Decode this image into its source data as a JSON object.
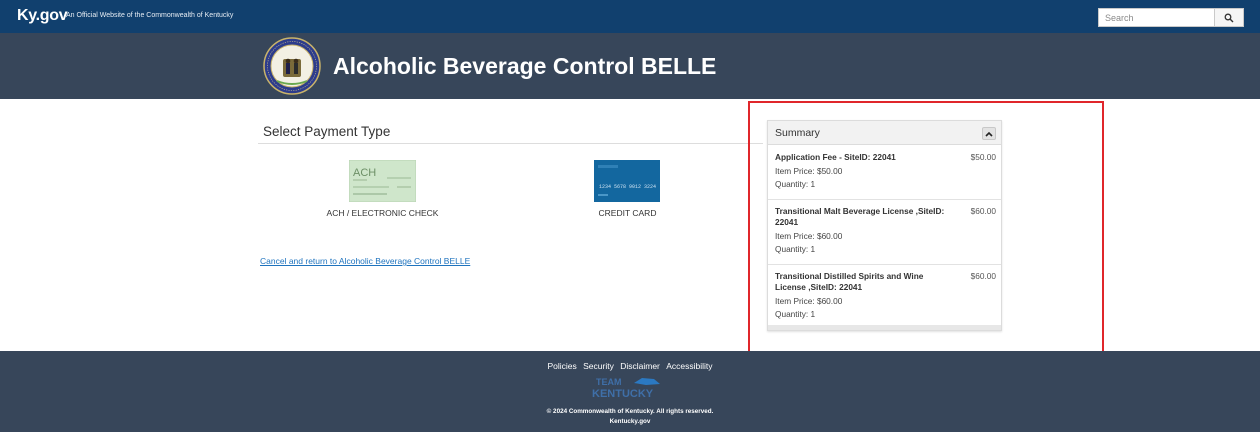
{
  "topbar": {
    "brand": "Ky.gov",
    "official_text": "An Official Website of the Commonwealth of Kentucky",
    "search_placeholder": "Search"
  },
  "header": {
    "title": "Alcoholic Beverage Control BELLE"
  },
  "payment": {
    "heading": "Select Payment Type",
    "ach_label": "ACH / ELECTRONIC CHECK",
    "card_label": "CREDIT CARD",
    "card_number": "1234 5678 9012 3224"
  },
  "cancel_link": "Cancel and return to Alcoholic Beverage Control BELLE",
  "summary": {
    "title": "Summary",
    "items": [
      {
        "name": "Application Fee - SiteID: 22041",
        "amount": "$50.00",
        "price": "Item Price: $50.00",
        "qty": "Quantity: 1"
      },
      {
        "name": "Transitional Malt Beverage License ,SiteID: 22041",
        "amount": "$60.00",
        "price": "Item Price: $60.00",
        "qty": "Quantity: 1"
      },
      {
        "name": "Transitional Distilled Spirits and Wine License ,SiteID: 22041",
        "amount": "$60.00",
        "price": "Item Price: $60.00",
        "qty": "Quantity: 1"
      }
    ]
  },
  "footer": {
    "links": [
      "Policies",
      "Security",
      "Disclaimer",
      "Accessibility"
    ],
    "logo_line1": "TEAM",
    "logo_line2": "KENTUCKY",
    "copyright": "© 2024 Commonwealth of Kentucky. All rights reserved.",
    "site": "Kentucky.gov"
  },
  "colors": {
    "topbar": "#11406e",
    "header": "#37465a",
    "link": "#1e73be",
    "highlight": "#e0262b"
  }
}
